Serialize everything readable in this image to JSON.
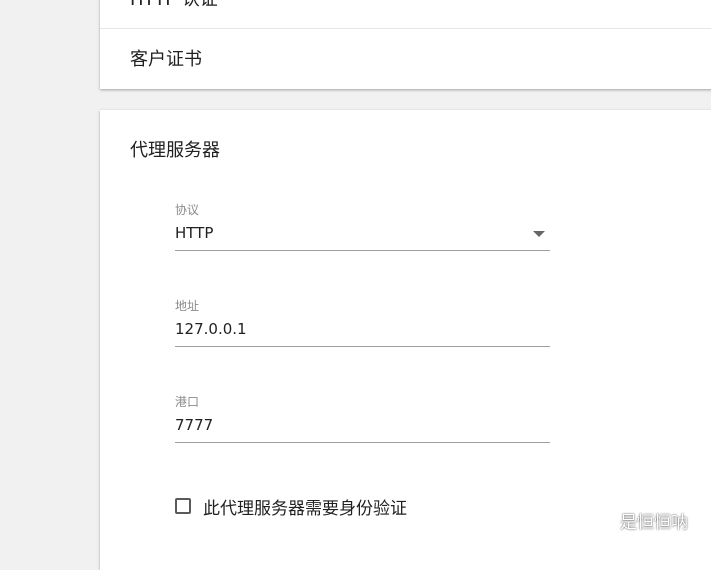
{
  "top_card": {
    "row1_label": "HTTP 认证",
    "row2_label": "客户证书"
  },
  "proxy": {
    "title": "代理服务器",
    "protocol": {
      "label": "协议",
      "value": "HTTP"
    },
    "address": {
      "label": "地址",
      "value": "127.0.0.1"
    },
    "port": {
      "label": "港口",
      "value": "7777"
    },
    "auth_checkbox": {
      "label": "此代理服务器需要身份验证",
      "checked": false
    }
  },
  "watermark": {
    "text": "是恒恒呐",
    "icon": "wechat-icon"
  }
}
